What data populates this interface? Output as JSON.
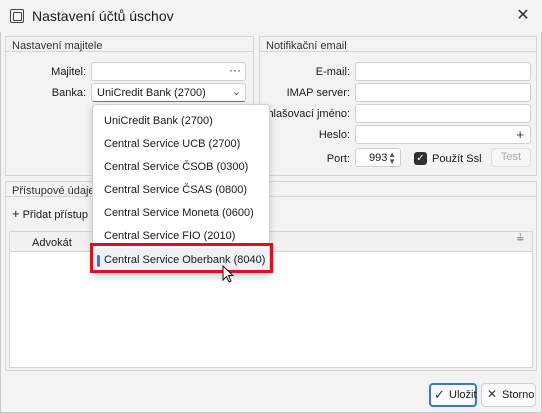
{
  "window": {
    "title": "Nastavení účtů úschov"
  },
  "owner_group": {
    "title": "Nastavení majitele",
    "owner_label": "Majitel:",
    "owner_value": "",
    "bank_label": "Banka:",
    "bank_value": "UniCredit Bank (2700)"
  },
  "bank_dropdown": {
    "items": [
      "UniCredit Bank (2700)",
      "Central Service UCB (2700)",
      "Central Service ČSOB (0300)",
      "Central Service ČSAS (0800)",
      "Central Service Moneta (0600)",
      "Central Service FIO (2010)",
      "Central Service Oberbank (8040)"
    ],
    "highlighted_index": 6
  },
  "email_group": {
    "title": "Notifikační email",
    "email_label": "E-mail:",
    "imap_label": "IMAP server:",
    "login_label": "Přihlašovací jméno:",
    "password_label": "Heslo:",
    "port_label": "Port:",
    "port_value": "993",
    "ssl_label": "Použít Ssl",
    "ssl_checked": true,
    "test_button": "Test"
  },
  "access_group": {
    "title": "Přístupové údaje o",
    "add_button": "Přidat přístup",
    "column_header": "Advokát"
  },
  "footer": {
    "save_button": "Uložit",
    "cancel_button": "Storno"
  },
  "colors": {
    "accent": "#3a78c9",
    "highlight": "#e0101a"
  }
}
